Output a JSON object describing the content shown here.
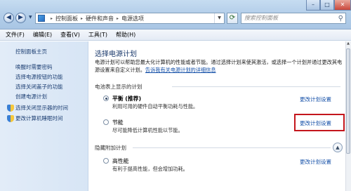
{
  "window": {
    "minimize_symbol": "–",
    "maximize_symbol": "□",
    "close_symbol": "✕"
  },
  "address_bar": {
    "crumbs": [
      "控制面板",
      "硬件和声音",
      "电源选项"
    ],
    "separator": "▸",
    "search_placeholder": "搜索控制面板"
  },
  "menu": [
    "文件(F)",
    "编辑(E)",
    "查看(V)",
    "工具(T)",
    "帮助(H)"
  ],
  "sidebar": {
    "home": "控制面板主页",
    "items": [
      "唤醒时需要密码",
      "选择电源按钮的功能",
      "选择关闭盖子的功能",
      "创建电源计划",
      "选择关闭显示器的时间",
      "更改计算机睡眠时间"
    ]
  },
  "main": {
    "title": "选择电源计划",
    "description_line1": "电源计划可以帮助您最大化计算机的性能或者节能。通过选择计划来使其激活，或选择一个计划并通过更改其电",
    "description_line2_prefix": "源设置来自定义计划。",
    "description_link": "告诉我有关电源计划的详细信息",
    "section_battery": "电池表上显示的计划",
    "section_hidden": "隐藏附加计划",
    "plans": [
      {
        "name": "平衡 (推荐)",
        "desc": "利用可用的硬件自动平衡功耗与性能。",
        "link": "更改计划设置"
      },
      {
        "name": "节能",
        "desc": "尽可能降低计算机性能以节能。",
        "link": "更改计划设置"
      },
      {
        "name": "高性能",
        "desc": "有利于提高性能，但会增加功耗。",
        "link": "更改计划设置"
      }
    ],
    "selected_plan_index": 0
  },
  "colors": {
    "link": "#1550a8",
    "highlight_box": "#c4161c",
    "sidebar_bg": "#dbe7f6"
  }
}
